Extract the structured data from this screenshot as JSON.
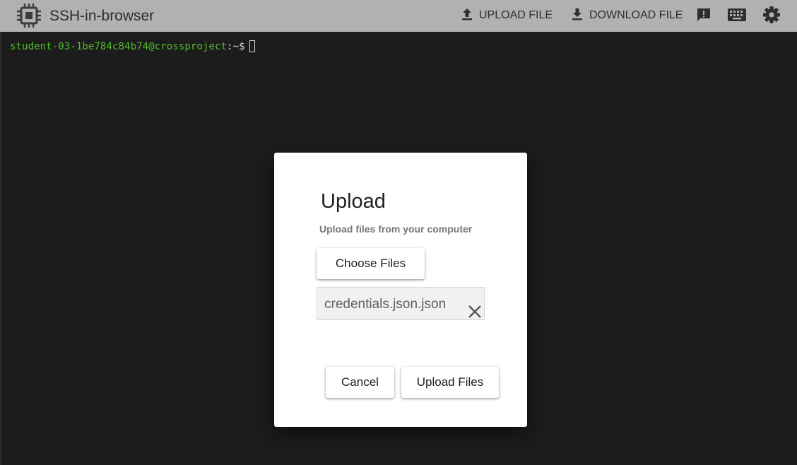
{
  "app": {
    "title": "SSH-in-browser",
    "icon": "chip-icon"
  },
  "toolbar": {
    "upload_label": "UPLOAD FILE",
    "download_label": "DOWNLOAD FILE",
    "icons": [
      "upload-icon",
      "download-icon",
      "feedback-icon",
      "keyboard-icon",
      "settings-icon"
    ]
  },
  "terminal": {
    "user_host": "student-03-1be784c84b74@crossproject",
    "path_prompt": ":~$"
  },
  "dialog": {
    "title": "Upload",
    "subtitle": "Upload files from your computer",
    "choose_label": "Choose Files",
    "file_name": "credentials.json.json",
    "cancel_label": "Cancel",
    "upload_label": "Upload Files"
  },
  "colors": {
    "topbar": "#b1b1b1",
    "terminal_bg": "#1c1c1c",
    "prompt_user": "#4fbc2d",
    "dialog_bg": "#ffffff"
  }
}
